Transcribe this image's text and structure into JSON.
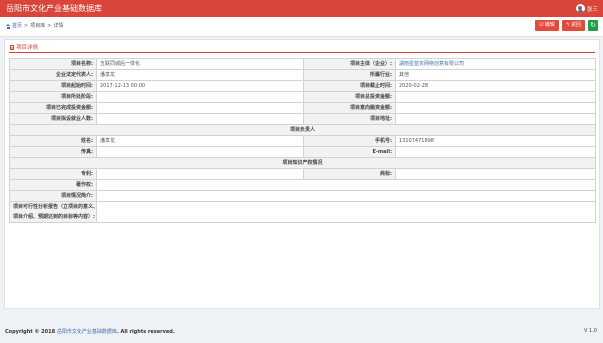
{
  "app": {
    "title": "岳阳市文化产业基础数据库",
    "user_name": "张三"
  },
  "breadcrumb": {
    "home": "首页",
    "sep1": ">",
    "list": "项目库",
    "sep2": ">",
    "current": "详情"
  },
  "toolbar": {
    "edit_icon": "☑",
    "edit_label": "编辑",
    "back_icon": "↰",
    "back_label": "返回",
    "refresh_icon": "↻"
  },
  "panel": {
    "title": "项目详情"
  },
  "fields": {
    "project_name_label": "项目名称:",
    "project_name": "五联同城后一体化",
    "project_owner_label": "项目主体（企业）:",
    "project_owner": "湖南星蓝农网络创意有限公司",
    "legal_rep_label": "企业法定代表人:",
    "legal_rep": "潘享龙",
    "industry_label": "所属行业:",
    "industry": "其他",
    "start_time_label": "项目起始时间:",
    "start_time": "2017-12-13 00:00",
    "end_time_label": "项目截止时间:",
    "end_time": "2020-02-28",
    "stage_label": "项目所处阶段:",
    "stage": "",
    "total_invest_label": "项目总投资金额:",
    "total_invest": "",
    "invested_label": "项目已完成投资金额:",
    "invested": "",
    "financing_label": "项目意向融资金额:",
    "financing": "",
    "employment_label": "项目拟设就业人数:",
    "employment": "",
    "address_label": "项目地址:",
    "address": ""
  },
  "section_manager": "项目负责人",
  "manager": {
    "name_label": "姓名:",
    "name": "潘享龙",
    "phone_label": "手机号:",
    "phone": "13107471898",
    "fax_label": "传真:",
    "fax": "",
    "email_label": "E-mail:",
    "email": ""
  },
  "section_ip": "项目知识产权情况",
  "ip": {
    "patent_label": "专利:",
    "patent": "",
    "trademark_label": "商标:",
    "trademark": "",
    "copyright_label": "著作权:",
    "copyright": "",
    "intro_label": "项目情况简介:",
    "intro": "",
    "feasibility_label_1": "项目可行性分析报告（立项目的意义、",
    "feasibility_label_2": "项目介绍、预期达到的目标等内容）:",
    "feasibility": ""
  },
  "footer": {
    "copyright_prefix": "Copyright © 2018",
    "org": "岳阳市文化产业基础数据库",
    "copyright_suffix": ". All rights reserved.",
    "version": "V 1.0"
  },
  "colors": {
    "brand_red": "#d9453a",
    "link_blue": "#3c6fae",
    "success_green": "#1f9e47"
  }
}
